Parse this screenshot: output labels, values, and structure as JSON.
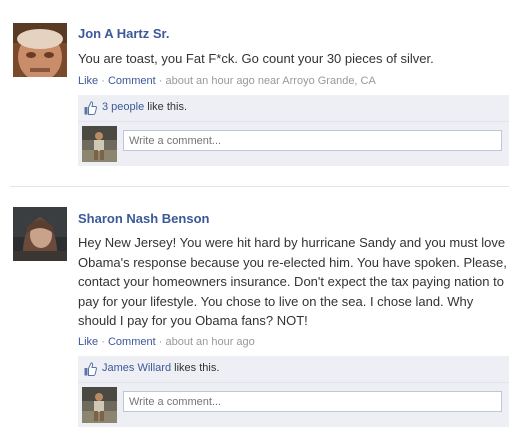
{
  "posts": [
    {
      "author": "Jon A Hartz Sr.",
      "message": "You are toast, you Fat F*ck. Go count your 30 pieces of silver.",
      "like_label": "Like",
      "sep": "·",
      "comment_label": "Comment",
      "time": "about an hour ago near Arroyo Grande, CA",
      "likes_link": "3 people",
      "likes_suffix": " like this.",
      "comment_placeholder": "Write a comment..."
    },
    {
      "author": "Sharon Nash Benson",
      "message": "Hey New Jersey! You were hit hard by hurricane Sandy and you must love Obama's response because you re-elected him. You have spoken. Please, contact your homeowners insurance. Don't expect the tax paying nation to pay for your lifestyle. You chose to live on the sea. I chose land. Why should I pay for you Obama fans? NOT!",
      "like_label": "Like",
      "sep": "·",
      "comment_label": "Comment",
      "time": "about an hour ago",
      "likes_link": "James Willard",
      "likes_suffix": " likes this.",
      "comment_placeholder": "Write a comment..."
    }
  ],
  "colors": {
    "link": "#3b5998",
    "meta": "#999999",
    "ufi_bg": "#edeff4"
  },
  "icons": {
    "like": "thumbs-up-icon"
  }
}
